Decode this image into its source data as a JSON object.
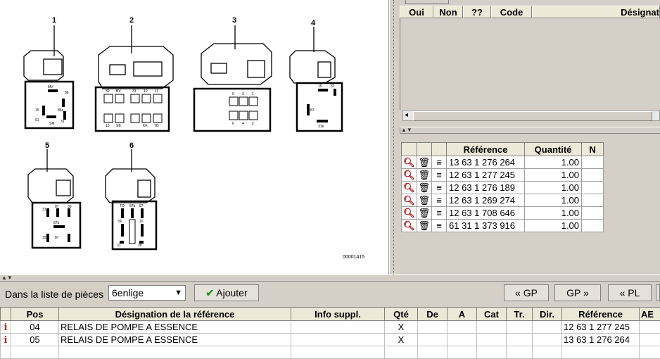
{
  "diagram": {
    "labels": [
      "1",
      "2",
      "3",
      "4",
      "5",
      "6"
    ],
    "code": "00001415",
    "pins": {
      "d1": [
        "MV",
        "86",
        "15",
        "85a",
        "61",
        "31",
        "SM"
      ],
      "d2": [
        "30",
        "BV",
        "31",
        "10",
        "LI",
        "15",
        "SB",
        "KK",
        "TD"
      ],
      "d3": [
        "5",
        "3",
        "1",
        "6",
        "4",
        "2"
      ],
      "d4": [
        "15",
        "31",
        "87",
        "31b"
      ],
      "d5": [
        "31",
        "87",
        "30",
        "87b",
        "15",
        "87"
      ],
      "d6": [
        "TD",
        "87b",
        "87",
        "50",
        "15",
        "31",
        "30"
      ]
    }
  },
  "right_top": {
    "columns": [
      "Oui",
      "Non",
      "??",
      "Code",
      "Désignat"
    ]
  },
  "ref_table": {
    "columns": [
      "Référence",
      "Quantité",
      "N"
    ],
    "rows": [
      {
        "ref": "13 63 1 276 264",
        "qty": "1.00"
      },
      {
        "ref": "12 63 1 277 245",
        "qty": "1.00"
      },
      {
        "ref": "12 63 1 276 189",
        "qty": "1.00"
      },
      {
        "ref": "12 63 1 269 274",
        "qty": "1.00"
      },
      {
        "ref": "12 63 1 708 646",
        "qty": "1.00"
      },
      {
        "ref": "61 31 1 373 916",
        "qty": "1.00"
      }
    ]
  },
  "toolbar": {
    "label": "Dans la liste de pièces",
    "select_value": "6enlige",
    "add_label": "Ajouter",
    "prev_gp": "« GP",
    "next_gp": "GP »",
    "prev_pl": "« PL"
  },
  "lower_table": {
    "columns": [
      "",
      "Pos",
      "Désignation de la référence",
      "Info suppl.",
      "Qté",
      "De",
      "A",
      "Cat",
      "Tr.",
      "Dir.",
      "Référence",
      "AE"
    ],
    "rows": [
      {
        "pos": "04",
        "designation": "RELAIS DE POMPE A ESSENCE",
        "info": "",
        "qty": "X",
        "ref": "12 63 1 277 245"
      },
      {
        "pos": "05",
        "designation": "RELAIS DE POMPE A ESSENCE",
        "info": "",
        "qty": "X",
        "ref": "13 63 1 276 264"
      }
    ]
  },
  "colors": {
    "info_icon": "#b22222",
    "add_check": "#1a9a1a",
    "panel_bg": "#d4d0c8"
  }
}
